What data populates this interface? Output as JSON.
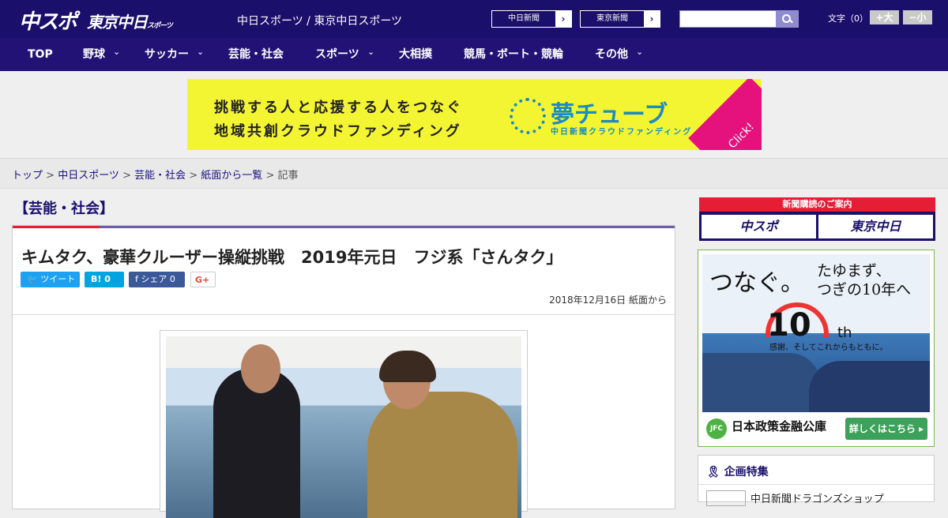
{
  "header": {
    "logo_chuspo": "中スポ",
    "logo_tokyo": "東京中日",
    "logo_tokyo_small": "スポーツ",
    "site_name": "中日スポーツ / 東京中日スポーツ",
    "paper_links": [
      {
        "label": "中日新聞"
      },
      {
        "label": "東京新聞"
      }
    ],
    "search_placeholder": "",
    "font_size_label": "文字（0）",
    "font_bigger": "+大",
    "font_smaller": "−小"
  },
  "nav": {
    "items": [
      {
        "label": "TOP"
      },
      {
        "label": "野球"
      },
      {
        "label": "サッカー"
      },
      {
        "label": "芸能・社会"
      },
      {
        "label": "スポーツ"
      },
      {
        "label": "大相撲"
      },
      {
        "label": "競馬・ボート・競輪"
      },
      {
        "label": "その他"
      }
    ],
    "chevron": "⌄"
  },
  "ad_banner": {
    "line1": "挑戦する人と応援する人をつなぐ",
    "line2": "地域共創クラウドファンディング",
    "brand": "夢チューブ",
    "brand_sub": "中日新聞クラウドファンディング",
    "click": "Click!"
  },
  "breadcrumb": {
    "items": [
      "トップ",
      "中日スポーツ",
      "芸能・社会",
      "紙面から一覧"
    ],
    "current": "記事",
    "sep": " > "
  },
  "article": {
    "category": "【芸能・社会】",
    "title": "キムタク、豪華クルーザー操縦挑戦　2019年元日　フジ系「さんタク」",
    "social": {
      "tweet": "ツイート",
      "hatena": "B!",
      "hatena_count": "0",
      "share": "シェア",
      "share_count": "0",
      "gplus": "G+"
    },
    "date": "2018年12月16日 紙面から"
  },
  "sidebar": {
    "subscribe_title": "新聞購読のご案内",
    "subscribe_chuspo": "中スポ",
    "subscribe_tokyo": "東京中日",
    "ad_tsunagu": "つなぐ。",
    "ad_tayumazu": "たゆまず、",
    "ad_tsugi": "つぎの10年へ",
    "ad_ten": "10",
    "ad_th": "th",
    "ad_thanks": "感謝、そしてこれからもともに。",
    "ad_jfc": "JFC",
    "ad_org": "日本政策金融公庫",
    "ad_more": "詳しくはこちら ▸",
    "kikaku_title": "企画特集",
    "kikaku_item": "中日新聞ドラゴンズショップ"
  }
}
